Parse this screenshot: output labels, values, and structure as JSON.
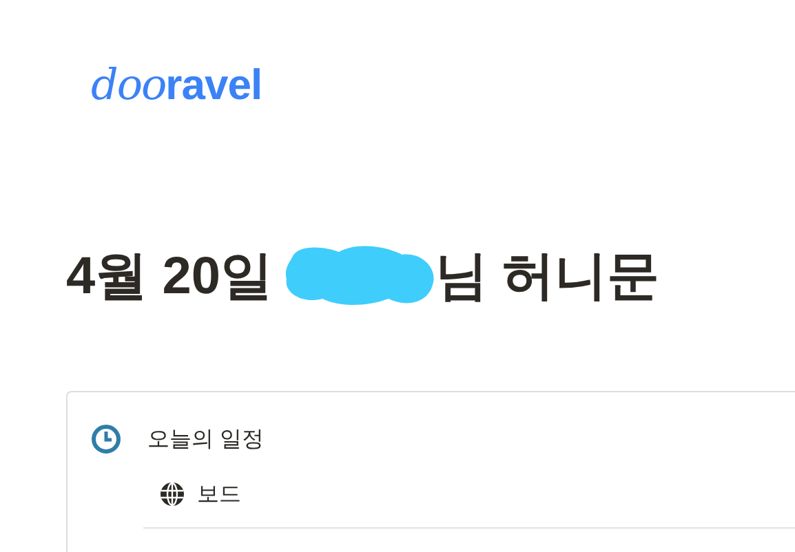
{
  "logo": {
    "script_part": "doo",
    "bold_part": "ravel"
  },
  "title": {
    "before": "4월 20일",
    "after": "님 허니문"
  },
  "schedule": {
    "heading": "오늘의 일정",
    "items": [
      {
        "label": "보드"
      }
    ]
  }
}
